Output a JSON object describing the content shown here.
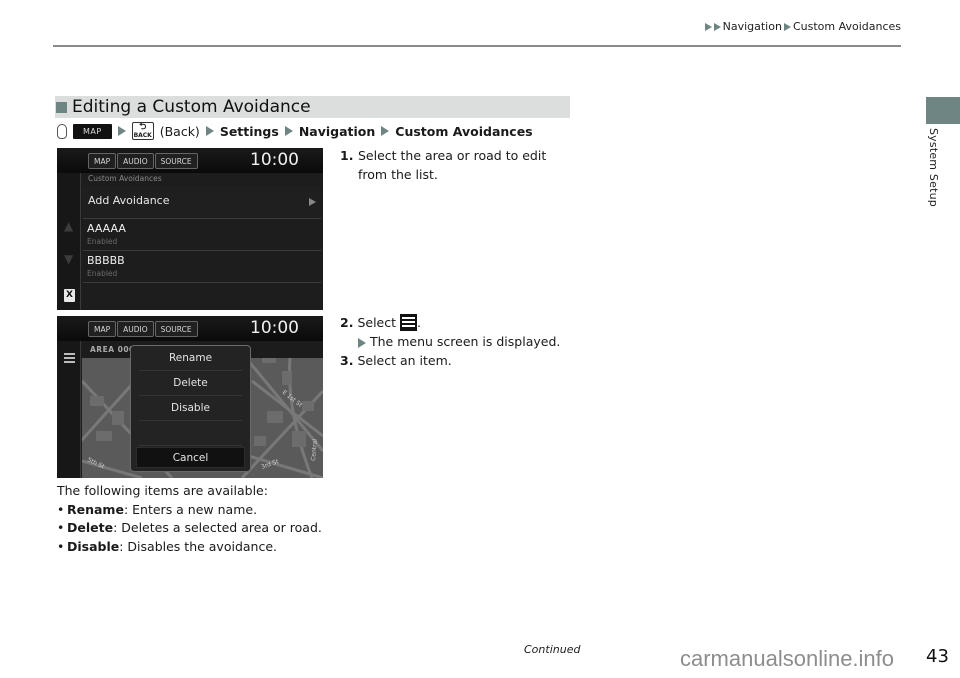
{
  "header": {
    "breadcrumb": [
      "Navigation",
      "Custom Avoidances"
    ]
  },
  "side_tab": {
    "label": "System Setup",
    "color": "#6f8583"
  },
  "section": {
    "title": "Editing a Custom Avoidance"
  },
  "path": {
    "map_button": "MAP",
    "back_icon_text": "BACK",
    "back_label": "(Back)",
    "steps": [
      "Settings",
      "Navigation",
      "Custom Avoidances"
    ]
  },
  "screen1": {
    "buttons": [
      "MAP",
      "AUDIO",
      "SOURCE"
    ],
    "clock": "10:00",
    "subtitle": "Custom Avoidances",
    "add_label": "Add Avoidance",
    "items": [
      {
        "name": "AAAAA",
        "status": "Enabled"
      },
      {
        "name": "BBBBB",
        "status": "Enabled"
      }
    ]
  },
  "screen2": {
    "buttons": [
      "MAP",
      "AUDIO",
      "SOURCE"
    ],
    "clock": "10:00",
    "area_label": "AREA 000",
    "menu_options": [
      "Rename",
      "Delete",
      "Disable"
    ],
    "cancel": "Cancel",
    "street_labels": [
      "E 1st St",
      "3rd St",
      "5th St",
      "Central"
    ]
  },
  "steps": {
    "step1": {
      "num": "1.",
      "text": "Select the area or road to edit from the list."
    },
    "step2": {
      "num": "2.",
      "pre": "Select",
      "post": ".",
      "result": "The menu screen is displayed."
    },
    "step3": {
      "num": "3.",
      "text": "Select an item."
    }
  },
  "available": {
    "intro": "The following items are available:",
    "items": [
      {
        "term": "Rename",
        "desc": ": Enters a new name."
      },
      {
        "term": "Delete",
        "desc": ": Deletes a selected area or road."
      },
      {
        "term": "Disable",
        "desc": ": Disables the avoidance."
      }
    ]
  },
  "footer": {
    "continued": "Continued",
    "page": "43",
    "watermark": "carmanualsonline.info"
  }
}
